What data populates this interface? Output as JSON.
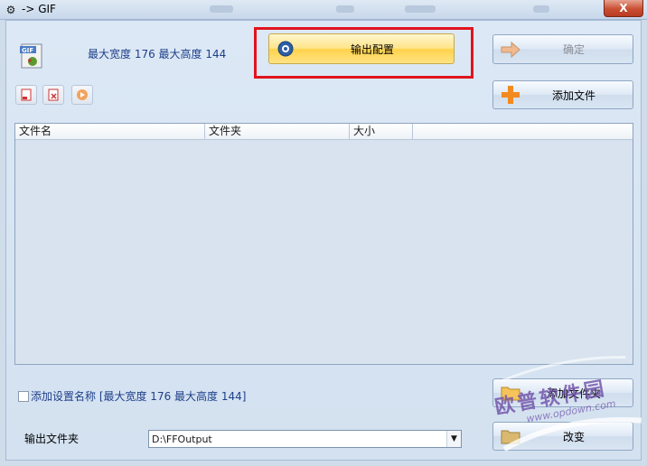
{
  "window": {
    "title": "-> GIF",
    "close": "X"
  },
  "info": {
    "size_text": "最大宽度 176 最大高度 144"
  },
  "buttons": {
    "output_config": "输出配置",
    "ok": "确定",
    "add_file": "添加文件",
    "add_folder": "添加文件夹",
    "change": "改变"
  },
  "file_list": {
    "columns": [
      "文件名",
      "文件夹",
      "大小"
    ]
  },
  "checkbox": {
    "label": "添加设置名称 [最大宽度 176 最大高度 144]",
    "checked": false
  },
  "output_folder": {
    "label": "输出文件夹",
    "value": "D:\\FFOutput"
  },
  "watermark": {
    "main": "欧普软件园",
    "sub": "www.opdown.com"
  },
  "colors": {
    "highlight": "#e0141e",
    "info_text": "#1e3f8a",
    "primary_button": "#ffd24a"
  }
}
